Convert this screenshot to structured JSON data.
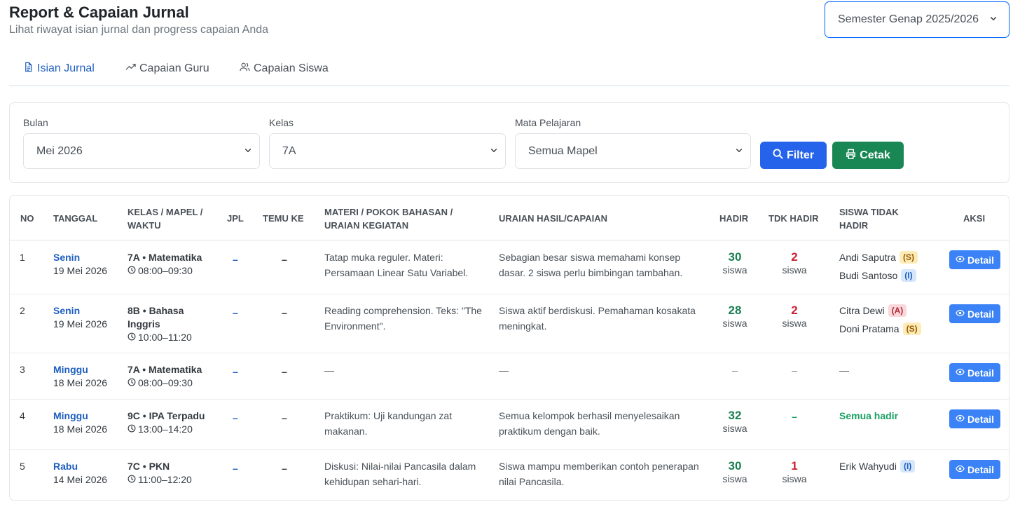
{
  "header": {
    "title": "Report & Capaian Jurnal",
    "subtitle": "Lihat riwayat isian jurnal dan progress capaian Anda",
    "semester": "Semester Genap 2025/2026"
  },
  "tabs": [
    {
      "label": "Isian Jurnal",
      "icon": "document-icon",
      "active": true
    },
    {
      "label": "Capaian Guru",
      "icon": "trending-up-icon",
      "active": false
    },
    {
      "label": "Capaian Siswa",
      "icon": "users-icon",
      "active": false
    }
  ],
  "filters": {
    "month_label": "Bulan",
    "month_value": "Mei 2026",
    "class_label": "Kelas",
    "class_value": "7A",
    "subject_label": "Mata Pelajaran",
    "subject_value": "Semua Mapel",
    "filter_button": "Filter",
    "print_button": "Cetak"
  },
  "table": {
    "headers": {
      "no": "NO",
      "tanggal": "TANGGAL",
      "kelas_line1": "KELAS / MAPEL /",
      "kelas_line2": "WAKTU",
      "jpl": "JPL",
      "temu": "TEMU KE",
      "materi_line1": "MATERI / POKOK BAHASAN /",
      "materi_line2": "URAIAN KEGIATAN",
      "uraian": "URAIAN HASIL/CAPAIAN",
      "hadir": "HADIR",
      "tdk_hadir": "TDK HADIR",
      "siswa_line1": "SISWA TIDAK",
      "siswa_line2": "HADIR",
      "aksi": "AKSI"
    },
    "rows": [
      {
        "no": "1",
        "day": "Senin",
        "date": "19 Mei 2026",
        "class_subject": "7A • Matematika",
        "time": "08:00–09:30",
        "jpl": "–",
        "temu": "–",
        "materi": "Tatap muka reguler. Materi: Persamaan Linear Satu Variabel.",
        "uraian": "Sebagian besar siswa memahami konsep dasar. 2 siswa perlu bimbingan tambahan.",
        "hadir": "30",
        "hadir_unit": "siswa",
        "tdk_hadir": "2",
        "tdk_unit": "siswa",
        "absent": [
          {
            "name": "Andi Saputra",
            "status": "(S)"
          },
          {
            "name": "Budi Santoso",
            "status": "(I)"
          }
        ],
        "action": "Detail"
      },
      {
        "no": "2",
        "day": "Senin",
        "date": "19 Mei 2026",
        "class_subject_line1": "8B • Bahasa",
        "class_subject_line2": "Inggris",
        "time": "10:00–11:20",
        "jpl": "–",
        "temu": "–",
        "materi": "Reading comprehension. Teks: \"The Environment\".",
        "uraian": "Siswa aktif berdiskusi. Pemahaman kosakata meningkat.",
        "hadir": "28",
        "hadir_unit": "siswa",
        "tdk_hadir": "2",
        "tdk_unit": "siswa",
        "absent": [
          {
            "name": "Citra Dewi",
            "status": "(A)"
          },
          {
            "name": "Doni Pratama",
            "status": "(S)"
          }
        ],
        "action": "Detail"
      },
      {
        "no": "3",
        "day": "Minggu",
        "date": "18 Mei 2026",
        "class_subject": "7A • Matematika",
        "time": "08:00–09:30",
        "jpl": "–",
        "temu": "–",
        "materi": "—",
        "uraian": "—",
        "hadir": "–",
        "tdk_hadir": "–",
        "absent_text": "—",
        "action": "Detail"
      },
      {
        "no": "4",
        "day": "Minggu",
        "date": "18 Mei 2026",
        "class_subject": "9C • IPA Terpadu",
        "time": "13:00–14:20",
        "jpl": "–",
        "temu": "–",
        "materi": "Praktikum: Uji kandungan zat makanan.",
        "uraian": "Semua kelompok berhasil menyelesaikan praktikum dengan baik.",
        "hadir": "32",
        "hadir_unit": "siswa",
        "tdk_hadir": "–",
        "absent_text": "Semua hadir",
        "action": "Detail"
      },
      {
        "no": "5",
        "day": "Rabu",
        "date": "14 Mei 2026",
        "class_subject": "7C • PKN",
        "time": "11:00–12:20",
        "jpl": "–",
        "temu": "–",
        "materi": "Diskusi: Nilai-nilai Pancasila dalam kehidupan sehari-hari.",
        "uraian": "Siswa mampu memberikan contoh penerapan nilai Pancasila.",
        "hadir": "30",
        "hadir_unit": "siswa",
        "tdk_hadir": "1",
        "tdk_unit": "siswa",
        "absent": [
          {
            "name": "Erik Wahyudi",
            "status": "(I)"
          }
        ],
        "action": "Detail"
      }
    ]
  },
  "colors": {
    "primary": "#2563eb",
    "success": "#198754",
    "link": "#1f5fbf",
    "present": "#1a7f52",
    "absent": "#c82333"
  }
}
